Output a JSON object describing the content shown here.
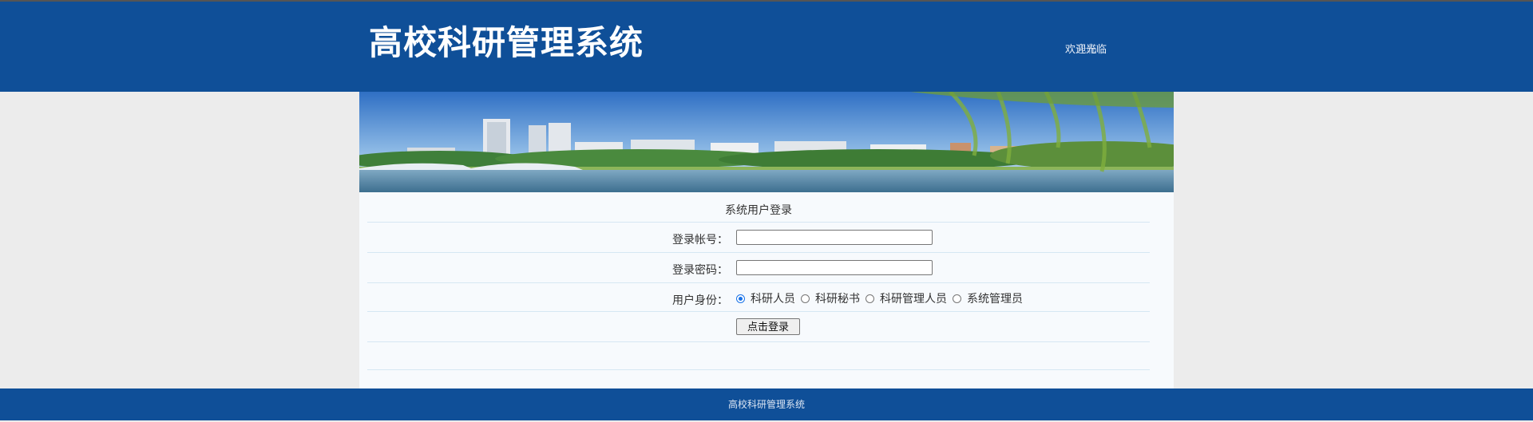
{
  "header": {
    "title": "高校科研管理系统",
    "welcome_text": "欢迎光临",
    "welcome_overlay": "光临"
  },
  "banner": {
    "description_icon": "campus-lake-photo"
  },
  "login": {
    "title": "系统用户登录",
    "username_label": "登录帐号：",
    "username_value": "",
    "password_label": "登录密码：",
    "password_value": "",
    "role_label": "用户身份：",
    "roles": [
      {
        "label": "科研人员",
        "checked": true
      },
      {
        "label": "科研秘书",
        "checked": false
      },
      {
        "label": "科研管理人员",
        "checked": false
      },
      {
        "label": "系统管理员",
        "checked": false
      }
    ],
    "submit_label": "点击登录"
  },
  "footer": {
    "text": "高校科研管理系统"
  },
  "colors": {
    "brand_blue": "#0f4f98",
    "page_bg": "#ececec",
    "panel_bg": "#f7fafd",
    "row_border": "#d6e7f3"
  }
}
